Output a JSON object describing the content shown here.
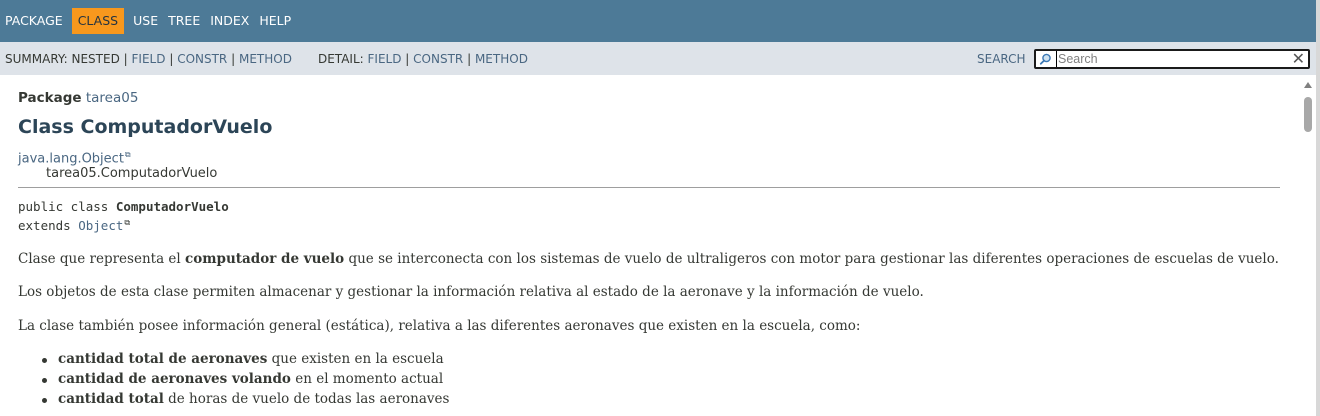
{
  "top_nav": {
    "items": [
      "PACKAGE",
      "CLASS",
      "USE",
      "TREE",
      "INDEX",
      "HELP"
    ],
    "active": "CLASS"
  },
  "sub_nav": {
    "summary_label": "SUMMARY:",
    "summary_nested": "NESTED",
    "summary_field": "FIELD",
    "summary_constr": "CONSTR",
    "summary_method": "METHOD",
    "detail_label": "DETAIL:",
    "detail_field": "FIELD",
    "detail_constr": "CONSTR",
    "detail_method": "METHOD",
    "separator": "|"
  },
  "search": {
    "label": "SEARCH",
    "placeholder": "Search",
    "reset_icon": "close-icon"
  },
  "header": {
    "package_label": "Package",
    "package_name": "tarea05",
    "class_title": "Class ComputadorVuelo",
    "inheritance_parent": "java.lang.Object",
    "inheritance_child": "tarea05.ComputadorVuelo"
  },
  "signature": {
    "modifiers": "public class ",
    "class_name": "ComputadorVuelo",
    "extends_kw": "extends ",
    "extends_type": "Object"
  },
  "description": {
    "p1_pre": "Clase que representa el ",
    "p1_bold": "computador de vuelo",
    "p1_post": " que se interconecta con los sistemas de vuelo de ultraligeros con motor para gestionar las diferentes operaciones de escuelas de vuelo.",
    "p2": "Los objetos de esta clase permiten almacenar y gestionar la información relativa al estado de la aeronave y la información de vuelo.",
    "p3": "La clase también posee información general (estática), relativa a las diferentes aeronaves que existen en la escuela, como:",
    "list": [
      {
        "bold": "cantidad total de aeronaves",
        "rest": " que existen en la escuela"
      },
      {
        "bold": "cantidad de aeronaves volando",
        "rest": " en el momento actual"
      },
      {
        "bold": "cantidad total",
        "rest": " de horas de vuelo de todas las aeronaves"
      }
    ]
  },
  "colors": {
    "nav_bg": "#4d7a97",
    "active_tab": "#f8981d",
    "subnav_bg": "#dee3e9",
    "link": "#4a6782"
  }
}
